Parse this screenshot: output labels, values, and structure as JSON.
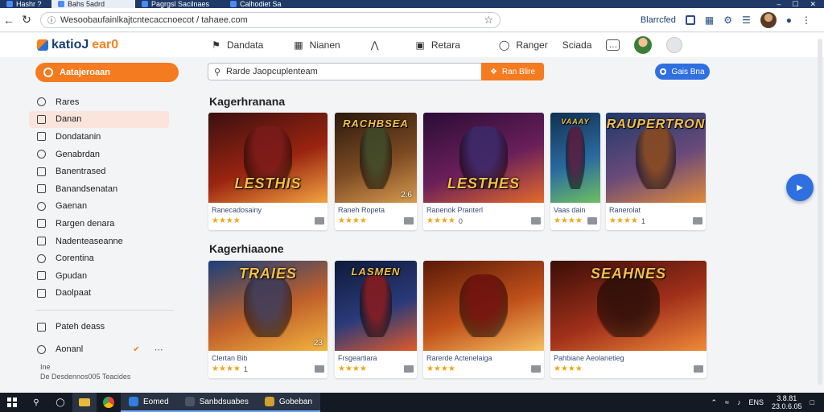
{
  "browser": {
    "tabs": [
      {
        "label": "Hashr ?",
        "active": false
      },
      {
        "label": "Bahs 5adrd",
        "active": true
      },
      {
        "label": "Pagrgsl Sacilnaes",
        "active": false
      },
      {
        "label": "Calhodiet Sa",
        "active": false
      }
    ],
    "url": "Wesoobaufainlkajtcntecaccnoecot / tahaee.com",
    "profile_label": "Blarrcfed",
    "window_controls": [
      "–",
      "☐",
      "✕"
    ]
  },
  "site": {
    "logo_text_1": "katioJ",
    "logo_text_2": "ear0",
    "nav": [
      {
        "label": "Dandata",
        "icon": "tag-icon"
      },
      {
        "label": "Nianen",
        "icon": "grid-icon"
      },
      {
        "label": "",
        "icon": "arrow-icon"
      },
      {
        "label": "Retara",
        "icon": "monitor-icon"
      }
    ],
    "header_right": [
      {
        "label": "Ranger",
        "icon": "shield-icon"
      },
      {
        "label": "Sciada",
        "icon": ""
      }
    ]
  },
  "sidebar": {
    "primary_pill": "Aatajeroaan",
    "items": [
      {
        "label": "Rares",
        "active": false
      },
      {
        "label": "Danan",
        "active": true
      },
      {
        "label": "Dondatanin",
        "active": false
      },
      {
        "label": "Genabrdan",
        "active": false
      },
      {
        "label": "Banentrased",
        "active": false
      },
      {
        "label": "Banandsenatan",
        "active": false
      },
      {
        "label": "Gaenan",
        "active": false
      },
      {
        "label": "Rargen denara",
        "active": false
      },
      {
        "label": "Nadenteaseanne",
        "active": false
      },
      {
        "label": "Corentina",
        "active": false
      },
      {
        "label": "Gpudan",
        "active": false
      },
      {
        "label": "Daolpaat",
        "active": false
      }
    ],
    "footer_items": [
      {
        "label": "Pateh deass"
      },
      {
        "label": "Aonanl"
      }
    ],
    "legal_1": "Ine",
    "legal_2": "De Desdennos005 Teacides"
  },
  "search": {
    "query": "Rarde Jaopcuplenteam",
    "button_label": "Ran Blire",
    "right_button_label": "Gais Bna"
  },
  "sections": [
    {
      "title": "Kagerhranana",
      "cards": [
        {
          "name": "Ranecadosainy",
          "count": "",
          "thumb_title": "LESTHIS",
          "badge": "",
          "grad": [
            "#3b1010",
            "#9a2410",
            "#f2a440"
          ],
          "hero": "#7a1a1a"
        },
        {
          "name": "Raneh Ropeta",
          "count": "",
          "thumb_title": "RACHBSEA",
          "badge": "2.6",
          "grad": [
            "#2a1a0e",
            "#7c4a22",
            "#d69a50"
          ],
          "hero": "#3c4a2a"
        },
        {
          "name": "Ranenok Pranterl",
          "count": "0",
          "thumb_title": "LESTHES",
          "badge": "",
          "grad": [
            "#2a0d36",
            "#6a1f5a",
            "#e46a2a"
          ],
          "hero": "#3a2a6a"
        },
        {
          "name": "Vaas dain",
          "count": "",
          "thumb_title": "VAAAY",
          "badge": "",
          "grad": [
            "#123050",
            "#2a6aa0",
            "#6ec060"
          ],
          "hero": "#5a1a3a"
        },
        {
          "name": "Ranerolat",
          "count": "1",
          "thumb_title": "RAUPERTRON",
          "badge": "",
          "grad": [
            "#1e3a6a",
            "#6a4a7a",
            "#e08a3a"
          ],
          "hero": "#8a4a1a"
        }
      ]
    },
    {
      "title": "Kagerhiaaone",
      "cards": [
        {
          "name": "Clertan Bib",
          "count": "1",
          "thumb_title": "TRAIES",
          "badge": "23",
          "grad": [
            "#1a3f7a",
            "#c0602a",
            "#f2b440"
          ],
          "hero": "#3a3a5a"
        },
        {
          "name": "Frsgeartiara",
          "count": "",
          "thumb_title": "LASMEN",
          "badge": "",
          "grad": [
            "#0e1a3a",
            "#2a3a7a",
            "#e05a2a"
          ],
          "hero": "#8a1a1a"
        },
        {
          "name": "Rarerde Actenelaiga",
          "count": "",
          "thumb_title": "",
          "badge": "",
          "grad": [
            "#5a1a08",
            "#c0501a",
            "#f6c060"
          ],
          "hero": "#6a0e0e"
        },
        {
          "name": "Pahbiane Aeolanetieg",
          "count": "",
          "thumb_title": "SEAHNES",
          "badge": "",
          "grad": [
            "#3a0e08",
            "#a0301a",
            "#f08a3a"
          ],
          "hero": "#2a0e08"
        }
      ]
    }
  ],
  "taskbar": {
    "apps": [
      {
        "label": "Eomed",
        "color": "#2f7ee0",
        "open": true
      },
      {
        "label": "Sanbdsuabes",
        "color": "#4a5566",
        "open": true
      },
      {
        "label": "Gobeban",
        "color": "#d0a030",
        "open": true
      }
    ],
    "tray_text": "ENS",
    "clock_time": "3.8.81",
    "clock_date": "23.0.6.05"
  },
  "colors": {
    "accent_orange": "#f47b20",
    "accent_blue": "#2f6fe0",
    "chrome_dark": "#1f3a66",
    "star": "#f2a516"
  }
}
